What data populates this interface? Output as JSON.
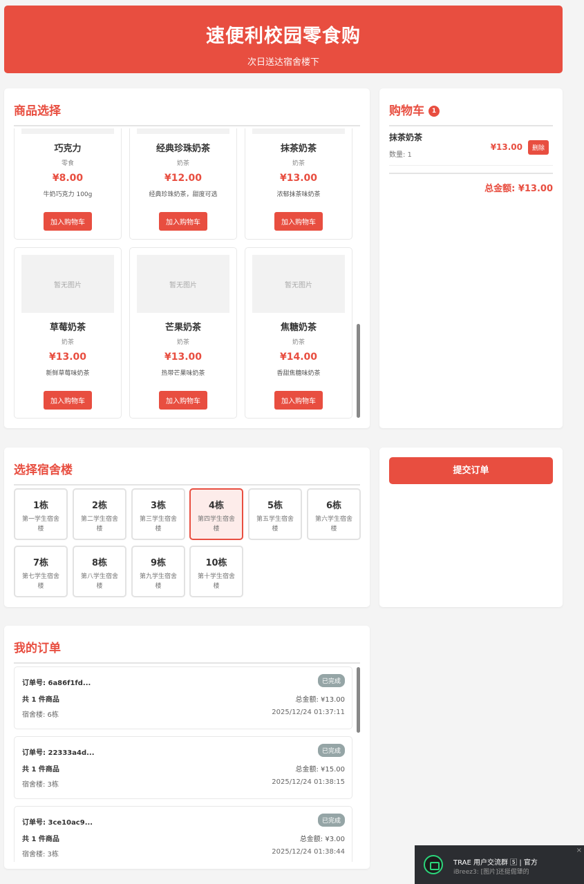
{
  "header": {
    "title": "速便利校园零食购",
    "subtitle": "次日送达宿舍楼下"
  },
  "products": {
    "title": "商品选择",
    "add_label": "加入购物车",
    "no_image": "暂无图片",
    "items": [
      {
        "name": "巧克力",
        "category": "零食",
        "price": "¥8.00",
        "desc": "牛奶巧克力 100g"
      },
      {
        "name": "经典珍珠奶茶",
        "category": "奶茶",
        "price": "¥12.00",
        "desc": "经典珍珠奶茶，甜度可选"
      },
      {
        "name": "抹茶奶茶",
        "category": "奶茶",
        "price": "¥13.00",
        "desc": "浓郁抹茶味奶茶"
      },
      {
        "name": "草莓奶茶",
        "category": "奶茶",
        "price": "¥13.00",
        "desc": "新鲜草莓味奶茶"
      },
      {
        "name": "芒果奶茶",
        "category": "奶茶",
        "price": "¥13.00",
        "desc": "热带芒果味奶茶"
      },
      {
        "name": "焦糖奶茶",
        "category": "奶茶",
        "price": "¥14.00",
        "desc": "香甜焦糖味奶茶"
      }
    ]
  },
  "cart": {
    "title": "购物车",
    "count": "1",
    "items": [
      {
        "name": "抹茶奶茶",
        "qty": "数量: 1",
        "price": "¥13.00",
        "delete_label": "删除"
      }
    ],
    "total": "总金额: ¥13.00"
  },
  "submit_label": "提交订单",
  "dorms": {
    "title": "选择宿舍楼",
    "selected": "4栋",
    "items": [
      {
        "name": "1栋",
        "desc": "第一学生宿舍楼"
      },
      {
        "name": "2栋",
        "desc": "第二学生宿舍楼"
      },
      {
        "name": "3栋",
        "desc": "第三学生宿舍楼"
      },
      {
        "name": "4栋",
        "desc": "第四学生宿舍楼"
      },
      {
        "name": "5栋",
        "desc": "第五学生宿舍楼"
      },
      {
        "name": "6栋",
        "desc": "第六学生宿舍楼"
      },
      {
        "name": "7栋",
        "desc": "第七学生宿舍楼"
      },
      {
        "name": "8栋",
        "desc": "第八学生宿舍楼"
      },
      {
        "name": "9栋",
        "desc": "第九学生宿舍楼"
      },
      {
        "name": "10栋",
        "desc": "第十学生宿舍楼"
      }
    ]
  },
  "orders": {
    "title": "我的订单",
    "items": [
      {
        "id": "订单号: 6a86f1fd...",
        "status": "已完成",
        "count": "共 1 件商品",
        "total": "总金额: ¥13.00",
        "dorm": "宿舍楼: 6栋",
        "time": "2025/12/24 01:37:11"
      },
      {
        "id": "订单号: 22333a4d...",
        "status": "已完成",
        "count": "共 1 件商品",
        "total": "总金额: ¥15.00",
        "dorm": "宿舍楼: 3栋",
        "time": "2025/12/24 01:38:15"
      },
      {
        "id": "订单号: 3ce10ac9...",
        "status": "已完成",
        "count": "共 1 件商品",
        "total": "总金额: ¥3.00",
        "dorm": "宿舍楼: 3栋",
        "time": "2025/12/24 01:38:44"
      }
    ]
  },
  "notification": {
    "title": "TRAE 用户交流群 🅂 | 官方",
    "message": "iBreez3: [图片]还挺倔犟的",
    "close": "×"
  }
}
